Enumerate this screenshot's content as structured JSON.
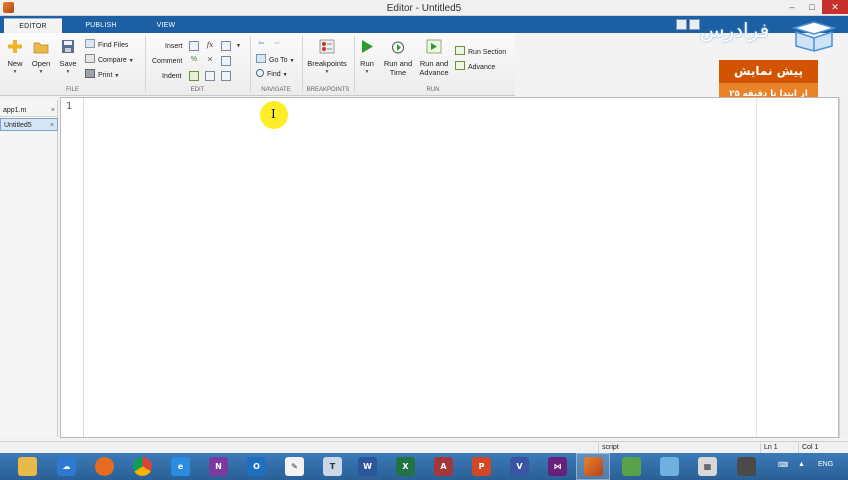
{
  "window": {
    "title": "Editor - Untitled5",
    "min": "–",
    "max": "□",
    "close": "✕"
  },
  "tabs": [
    {
      "label": "EDITOR",
      "active": true
    },
    {
      "label": "PUBLISH",
      "active": false
    },
    {
      "label": "VIEW",
      "active": false
    }
  ],
  "ribbon": {
    "file": {
      "group": "FILE",
      "new": "New",
      "open": "Open",
      "save": "Save",
      "find_files": "Find Files",
      "compare": "Compare",
      "print": "Print"
    },
    "edit": {
      "group": "EDIT",
      "insert": "Insert",
      "comment": "Comment",
      "indent": "Indent",
      "fx": "fx"
    },
    "navigate": {
      "group": "NAVIGATE",
      "goto": "Go To",
      "find": "Find"
    },
    "breakpoints": {
      "group": "BREAKPOINTS",
      "breakpoints": "Breakpoints"
    },
    "run": {
      "group": "RUN",
      "run": "Run",
      "run_and_time": "Run and Time",
      "run_and_advance": "Run and Advance",
      "run_section": "Run Section",
      "advance": "Advance"
    }
  },
  "promo": {
    "logo": "فرادرس",
    "title": "پیش نمایش",
    "subtitle": "از ابتدا تا دقیقه ۲۵"
  },
  "files": [
    {
      "name": "app1.m",
      "active": false
    },
    {
      "name": "Untitled5",
      "active": true
    }
  ],
  "editor": {
    "line_number": "1",
    "close_x": "×"
  },
  "status": {
    "mode": "script",
    "ln": "Ln  1",
    "col": "Col  1"
  },
  "taskbar": {
    "lang": "ENG"
  },
  "colors": {
    "accent": "#1c5fa3",
    "promo_dark": "#d35400",
    "promo_light": "#e8832a",
    "taskbar": "#2a5f96"
  }
}
